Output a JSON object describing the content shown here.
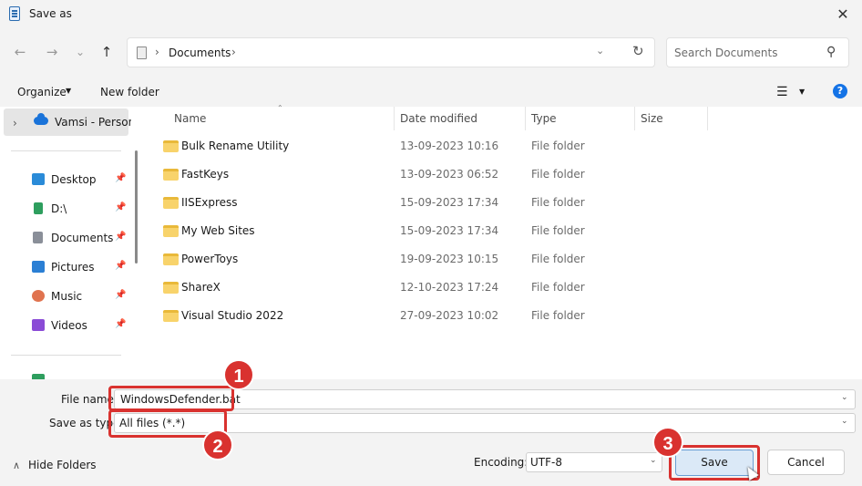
{
  "window": {
    "title": "Save as",
    "close_glyph": "✕"
  },
  "nav": {
    "back_glyph": "←",
    "forward_glyph": "→",
    "recent_glyph": "⌄",
    "up_glyph": "↑",
    "address": "Documents",
    "address_sep": "›",
    "refresh_glyph": "↻",
    "dropdown_glyph": "⌄",
    "search_placeholder": "Search Documents",
    "search_glyph": "⚲"
  },
  "commandbar": {
    "organize": "Organize",
    "caret": "▼",
    "new_folder": "New folder",
    "view_glyph": "☰",
    "help_glyph": "?"
  },
  "sidebar": {
    "expand_glyph": "›",
    "onedrive": "Vamsi - Personal",
    "pin_glyph": "📌",
    "items": [
      {
        "label": "Desktop",
        "icon": "desktop-icon",
        "color": "#2a8bd8"
      },
      {
        "label": "D:\\",
        "icon": "download-icon",
        "color": "#2e9e5e"
      },
      {
        "label": "Documents",
        "icon": "documents-icon",
        "color": "#8a8f99"
      },
      {
        "label": "Pictures",
        "icon": "pictures-icon",
        "color": "#2b7fd4"
      },
      {
        "label": "Music",
        "icon": "music-icon",
        "color": "#e0734f"
      },
      {
        "label": "Videos",
        "icon": "videos-icon",
        "color": "#8a4bd6"
      }
    ]
  },
  "columns": {
    "name": "Name",
    "date": "Date modified",
    "type": "Type",
    "size": "Size",
    "sort_glyph": "⌃"
  },
  "files": [
    {
      "name": "Bulk Rename Utility",
      "date": "13-09-2023 10:16",
      "type": "File folder"
    },
    {
      "name": "FastKeys",
      "date": "13-09-2023 06:52",
      "type": "File folder"
    },
    {
      "name": "IISExpress",
      "date": "15-09-2023 17:34",
      "type": "File folder"
    },
    {
      "name": "My Web Sites",
      "date": "15-09-2023 17:34",
      "type": "File folder"
    },
    {
      "name": "PowerToys",
      "date": "19-09-2023 10:15",
      "type": "File folder"
    },
    {
      "name": "ShareX",
      "date": "12-10-2023 17:24",
      "type": "File folder"
    },
    {
      "name": "Visual Studio 2022",
      "date": "27-09-2023 10:02",
      "type": "File folder"
    }
  ],
  "form": {
    "filename_label": "File name:",
    "filename_value": "WindowsDefender.bat",
    "savetype_label": "Save as type:",
    "savetype_value": "All files  (*.*)",
    "dd_glyph": "⌄",
    "hide_folders": "Hide Folders",
    "hide_caret": "∧",
    "encoding_label": "Encoding:",
    "encoding_value": "UTF-8",
    "save": "Save",
    "cancel": "Cancel"
  },
  "annotations": {
    "badge1": "1",
    "badge2": "2",
    "badge3": "3",
    "highlight_color": "#d9322f"
  }
}
